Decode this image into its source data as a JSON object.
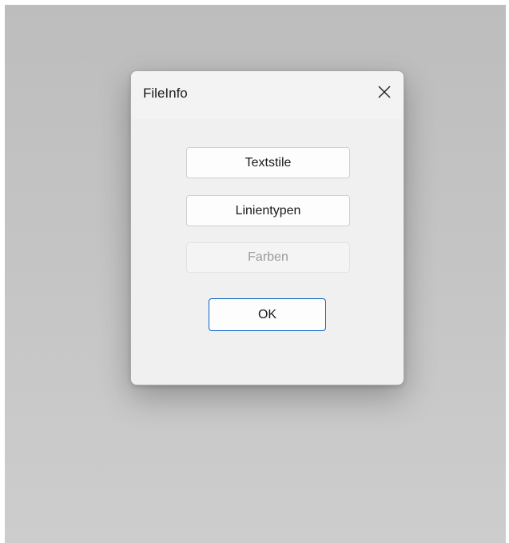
{
  "dialog": {
    "title": "FileInfo",
    "close_icon": "close-icon"
  },
  "buttons": {
    "textstile": "Textstile",
    "linientypen": "Linientypen",
    "farben": "Farben",
    "ok": "OK"
  },
  "colors": {
    "default_button_border": "#0a64c8",
    "disabled_text": "#9b9b9b"
  }
}
